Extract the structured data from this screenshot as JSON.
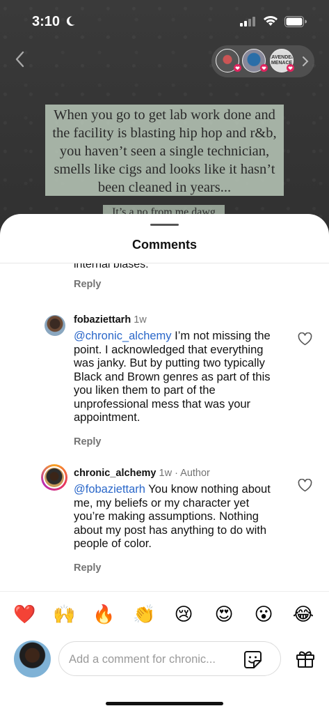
{
  "status_bar": {
    "time": "3:10"
  },
  "post": {
    "quote_text": "When you go to get lab work done and the facility is blasting hip hop and r&b, you haven’t seen a single technician, smells like cigs and looks like it hasn’t been cleaned in years...",
    "quote_text_2": "It’s a no from me dawg",
    "story_badge_3": "LAVENDER MENACE"
  },
  "sheet": {
    "title": "Comments"
  },
  "comments": {
    "previous_tail": "internal biases.",
    "reply_label": "Reply",
    "items": [
      {
        "username": "fobaziettarh",
        "time": "1w",
        "author_tag": "",
        "mention": "@chronic_alchemy",
        "body": " I’m not missing the point. I acknowledged that everything was janky. But by putting two typically Black and Brown genres as part of this you liken them to part of the unprofessional mess that was your appointment."
      },
      {
        "username": "chronic_alchemy",
        "time": "1w",
        "author_tag": " · Author",
        "mention": "@fobaziettarh",
        "body": " You know nothing about me, my beliefs or my character yet you’re making assumptions. Nothing about my post has anything to do with people of color."
      }
    ]
  },
  "emoji_bar": [
    "❤️",
    "🙌",
    "🔥",
    "👏",
    "😢",
    "😍",
    "😮",
    "😂"
  ],
  "composer": {
    "placeholder": "Add a comment for chronic..."
  },
  "colors": {
    "mention": "#2a67c9",
    "meta": "#737373"
  }
}
